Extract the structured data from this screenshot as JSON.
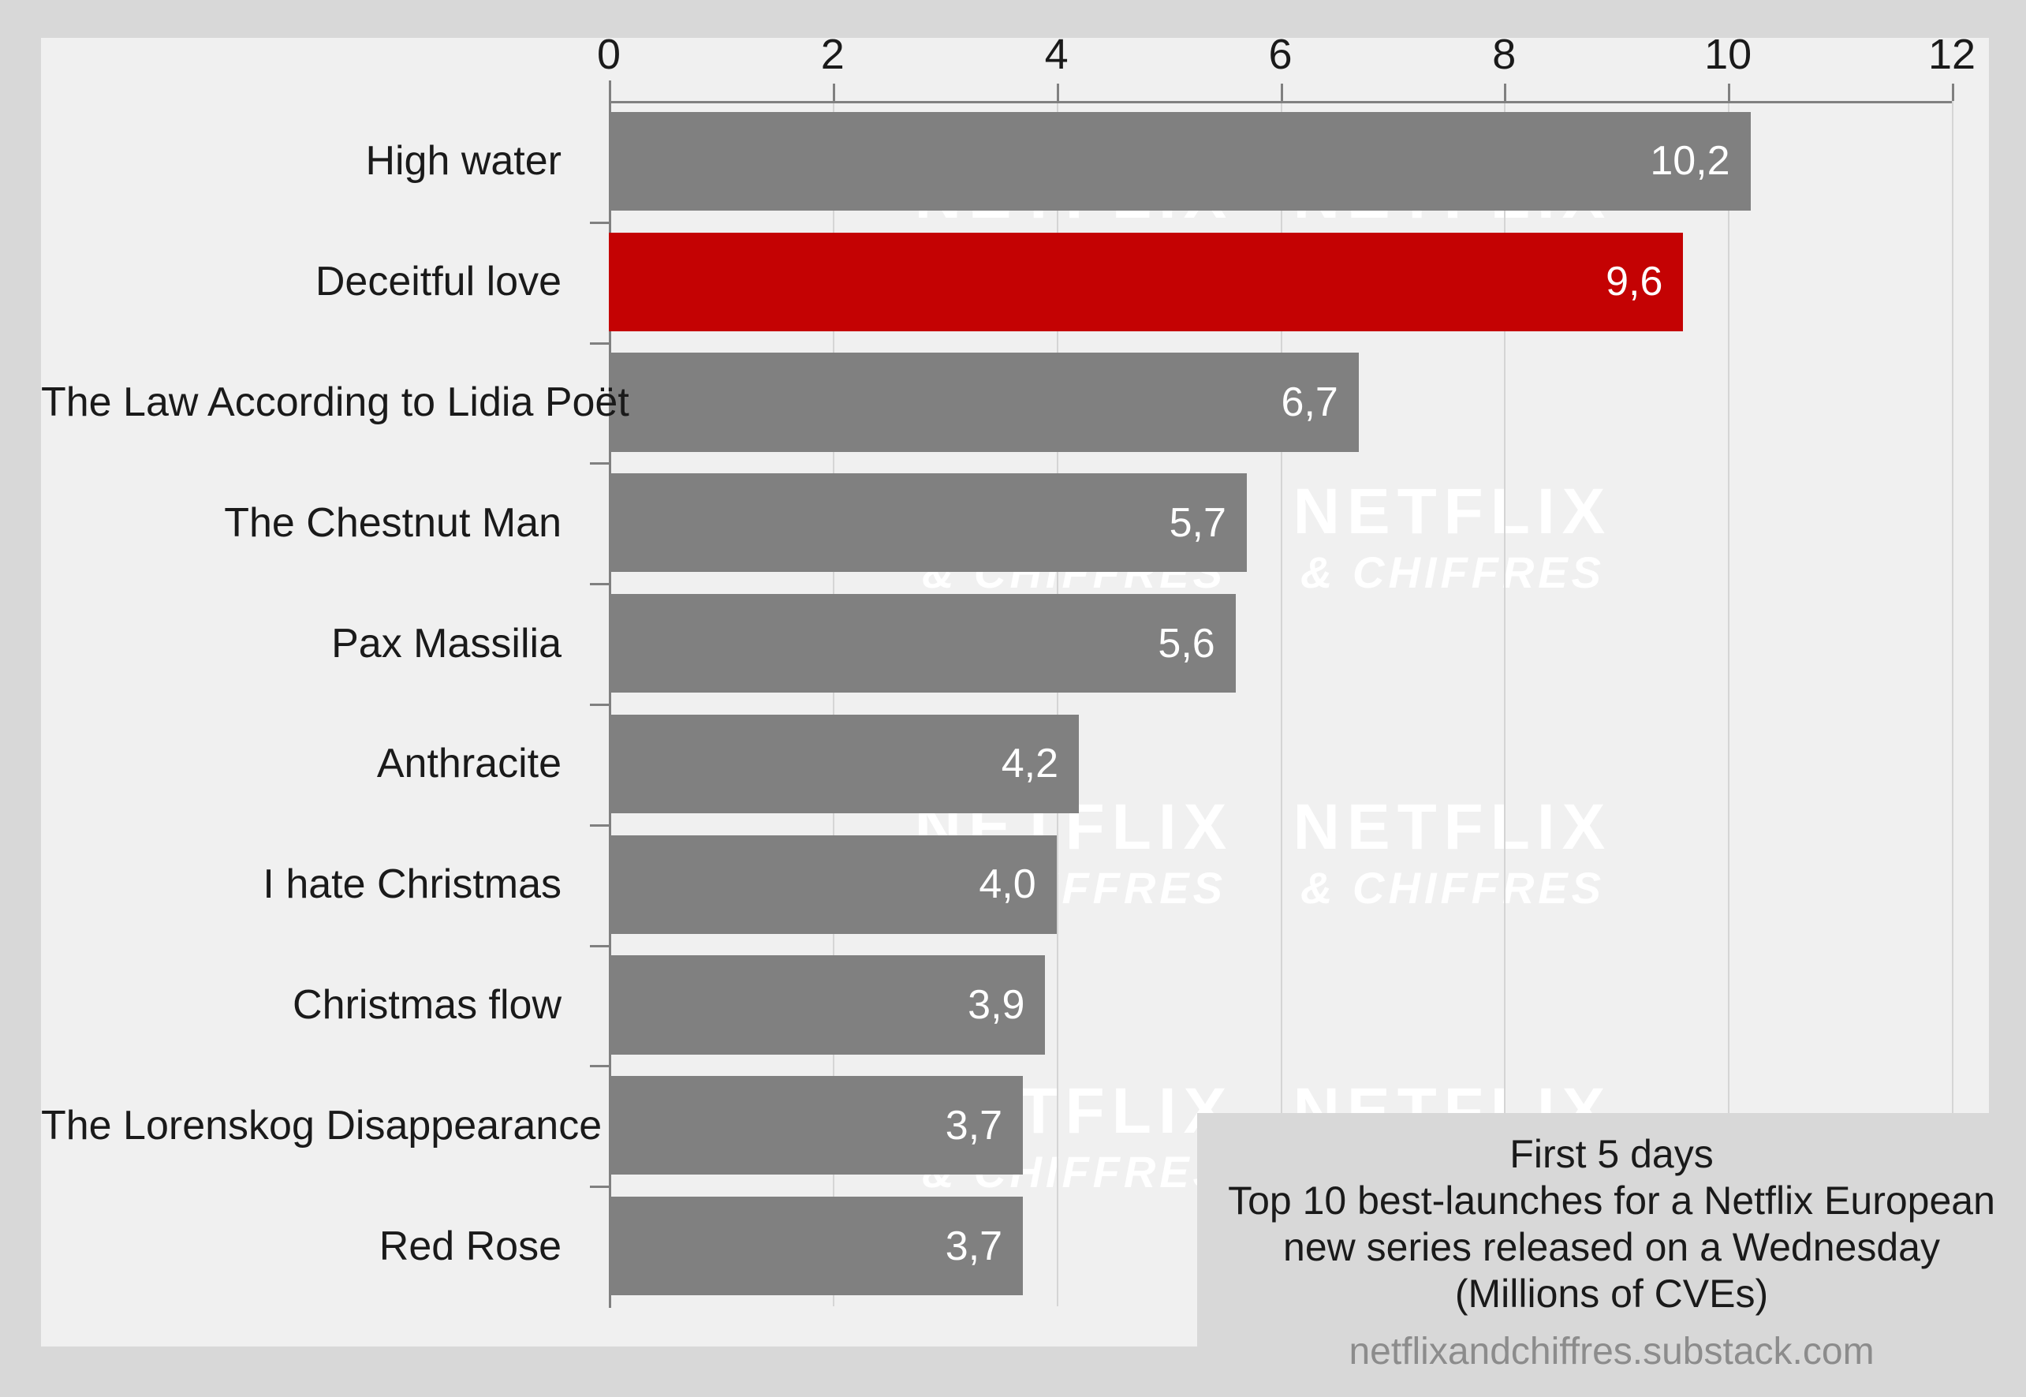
{
  "colors": {
    "figure_background": "#d8d8d8",
    "panel_background": "#f0f0f0",
    "bar_default": "#808080",
    "bar_highlight": "#c40203",
    "gridline": "#d5d5d5",
    "spine": "#808080",
    "value_label": "#ffffff",
    "tick_label": "#1a1a1a",
    "caption_background": "#d8d8d8",
    "caption_source": "#8c8c8c",
    "watermark": "#ffffff"
  },
  "watermark": {
    "line1": "NETFLIX",
    "line2": "& CHIFFRES"
  },
  "caption": {
    "line1": "First 5 days",
    "line2": "Top 10 best-launches for a Netflix European",
    "line3": "new series released on a Wednesday",
    "line4": "(Millions of CVEs)",
    "source": "netflixandchiffres.substack.com"
  },
  "chart_data": {
    "type": "bar",
    "orientation": "horizontal",
    "title": "",
    "subtitle": "",
    "xlabel": "",
    "ylabel": "",
    "xlim": [
      0,
      12
    ],
    "xticks": [
      0,
      2,
      4,
      6,
      8,
      10,
      12
    ],
    "xticklabels": [
      "0",
      "2",
      "4",
      "6",
      "8",
      "10",
      "12"
    ],
    "xaxis_position": "top",
    "grid": true,
    "legend": false,
    "decimal_separator": ",",
    "units": "Millions of CVEs",
    "categories": [
      "High water",
      "Deceitful love",
      "The Law According to Lidia Poët",
      "The Chestnut Man",
      "Pax Massilia",
      "Anthracite",
      "I hate Christmas",
      "Christmas flow",
      "The Lorenskog Disappearance",
      "Red Rose"
    ],
    "values": [
      10.2,
      9.6,
      6.7,
      5.7,
      5.6,
      4.2,
      4.0,
      3.9,
      3.7,
      3.7
    ],
    "value_labels": [
      "10,2",
      "9,6",
      "6,7",
      "5,7",
      "5,6",
      "4,2",
      "4,0",
      "3,9",
      "3,7",
      "3,7"
    ],
    "highlight_index": 1,
    "bars": [
      {
        "label": "High water",
        "value": 10.2,
        "value_label": "10,2",
        "highlight": false
      },
      {
        "label": "Deceitful love",
        "value": 9.6,
        "value_label": "9,6",
        "highlight": true
      },
      {
        "label": "The Law According to Lidia Poët",
        "value": 6.7,
        "value_label": "6,7",
        "highlight": false
      },
      {
        "label": "The Chestnut Man",
        "value": 5.7,
        "value_label": "5,7",
        "highlight": false
      },
      {
        "label": "Pax Massilia",
        "value": 5.6,
        "value_label": "5,6",
        "highlight": false
      },
      {
        "label": "Anthracite",
        "value": 4.2,
        "value_label": "4,2",
        "highlight": false
      },
      {
        "label": "I hate Christmas",
        "value": 4.0,
        "value_label": "4,0",
        "highlight": false
      },
      {
        "label": "Christmas flow",
        "value": 3.9,
        "value_label": "3,9",
        "highlight": false
      },
      {
        "label": "The Lorenskog Disappearance",
        "value": 3.7,
        "value_label": "3,7",
        "highlight": false
      },
      {
        "label": "Red Rose",
        "value": 3.7,
        "value_label": "3,7",
        "highlight": false
      }
    ]
  }
}
